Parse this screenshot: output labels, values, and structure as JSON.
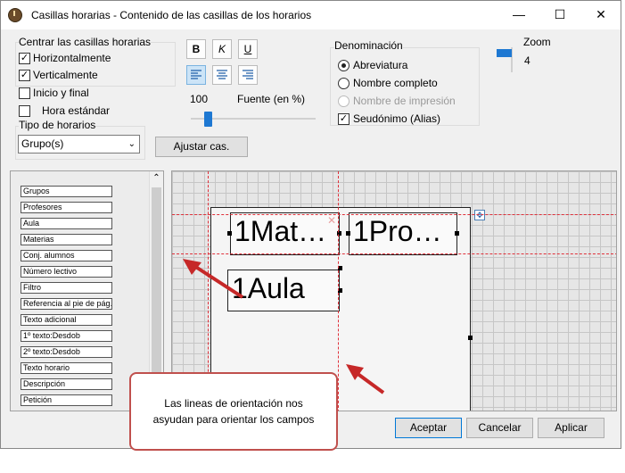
{
  "window": {
    "title": "Casillas horarias - Contenido de las casillas de los horarios",
    "minimize": "—",
    "maximize": "☐",
    "close": "✕"
  },
  "center": {
    "group_label": "Centrar las casillas horarias",
    "horizontal": {
      "label": "Horizontalmente",
      "checked": true
    },
    "vertical": {
      "label": "Verticalmente",
      "checked": true
    }
  },
  "inicio_final": {
    "label": "Inicio y final",
    "checked": false
  },
  "hora_estandar": {
    "label": "Hora estándar",
    "checked": false
  },
  "tipo": {
    "label": "Tipo de horarios",
    "value": "Grupo(s)"
  },
  "format": {
    "bold": "B",
    "italic": "K",
    "underline": "U"
  },
  "font": {
    "size": "100",
    "label": "Fuente (en %)"
  },
  "ajustar": "Ajustar cas.",
  "denominacion": {
    "label": "Denominación",
    "abreviatura": "Abreviatura",
    "completo": "Nombre completo",
    "impresion": "Nombre de impresión",
    "seudonimo": "Seudónimo (Alias)",
    "selected": "Abreviatura",
    "seudonimo_checked": true
  },
  "zoom": {
    "label": "Zoom",
    "value": "4"
  },
  "fields": [
    "Grupos",
    "Profesores",
    "Aula",
    "Materias",
    "Conj. alumnos",
    "Número lectivo",
    "Filtro",
    "Referencia al pie de pág.",
    "Texto adicional",
    "1º texto:Desdob",
    "2º texto:Desdob",
    "Texto horario",
    "Descripción",
    "Petición"
  ],
  "canvas": {
    "field1": "1Mat…",
    "field2": "1Pro…",
    "field3": "1Aula"
  },
  "callout": {
    "line1": "Las lineas de orientación nos",
    "line2": "asyudan para orientar los campos"
  },
  "buttons": {
    "ok": "Aceptar",
    "cancel": "Cancelar",
    "apply": "Aplicar"
  },
  "colors": {
    "guide": "#e0303a",
    "arrow": "#c62828",
    "callout_border": "#c0504d",
    "accent": "#0078d7"
  }
}
